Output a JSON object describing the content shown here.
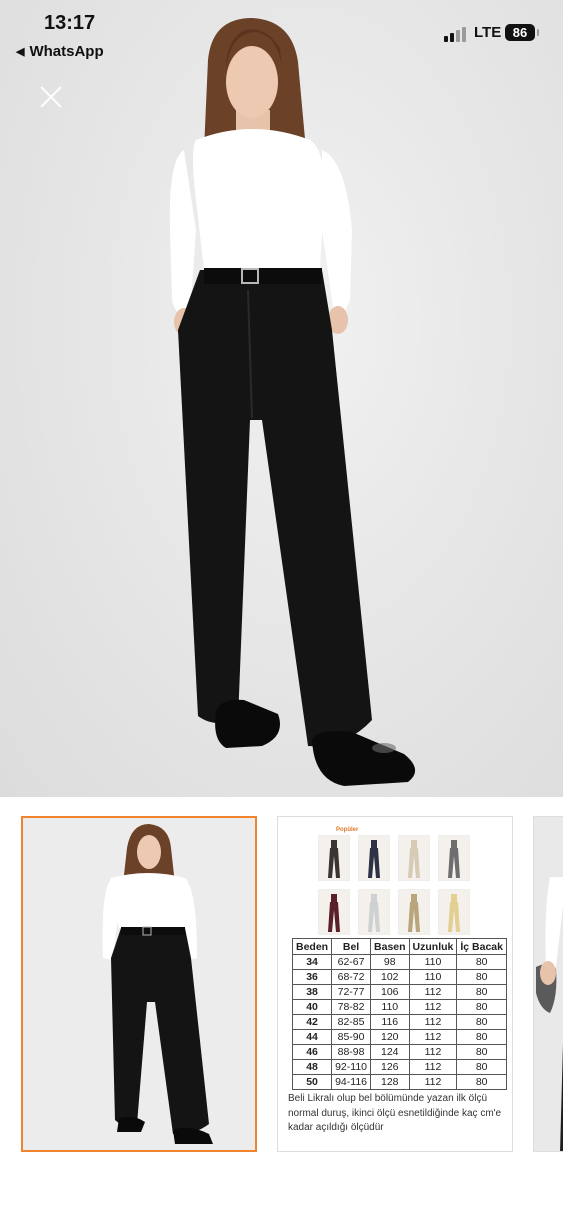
{
  "status_bar": {
    "time": "13:17",
    "back_label": "WhatsApp",
    "network": "LTE",
    "battery": "86"
  },
  "product_colors": {
    "background": "#e4e4e4",
    "top": "#ffffff",
    "trousers": "#141414",
    "thumb_border": "#f0842c"
  },
  "size_chart": {
    "badge": "Popüler",
    "headers": [
      "Beden",
      "Bel",
      "Basen",
      "Uzunluk",
      "İç Bacak"
    ],
    "rows": [
      [
        "34",
        "62-67",
        "98",
        "110",
        "80"
      ],
      [
        "36",
        "68-72",
        "102",
        "110",
        "80"
      ],
      [
        "38",
        "72-77",
        "106",
        "112",
        "80"
      ],
      [
        "40",
        "78-82",
        "110",
        "112",
        "80"
      ],
      [
        "42",
        "82-85",
        "116",
        "112",
        "80"
      ],
      [
        "44",
        "85-90",
        "120",
        "112",
        "80"
      ],
      [
        "46",
        "88-98",
        "124",
        "112",
        "80"
      ],
      [
        "48",
        "92-110",
        "126",
        "112",
        "80"
      ],
      [
        "50",
        "94-116",
        "128",
        "112",
        "80"
      ]
    ],
    "note": "Beli Likralı olup bel bölümünde yazan ilk ölçü normal duruş, ikinci ölçü esnetildiğinde kaç cm'e  kadar açıldığı ölçüdür"
  }
}
